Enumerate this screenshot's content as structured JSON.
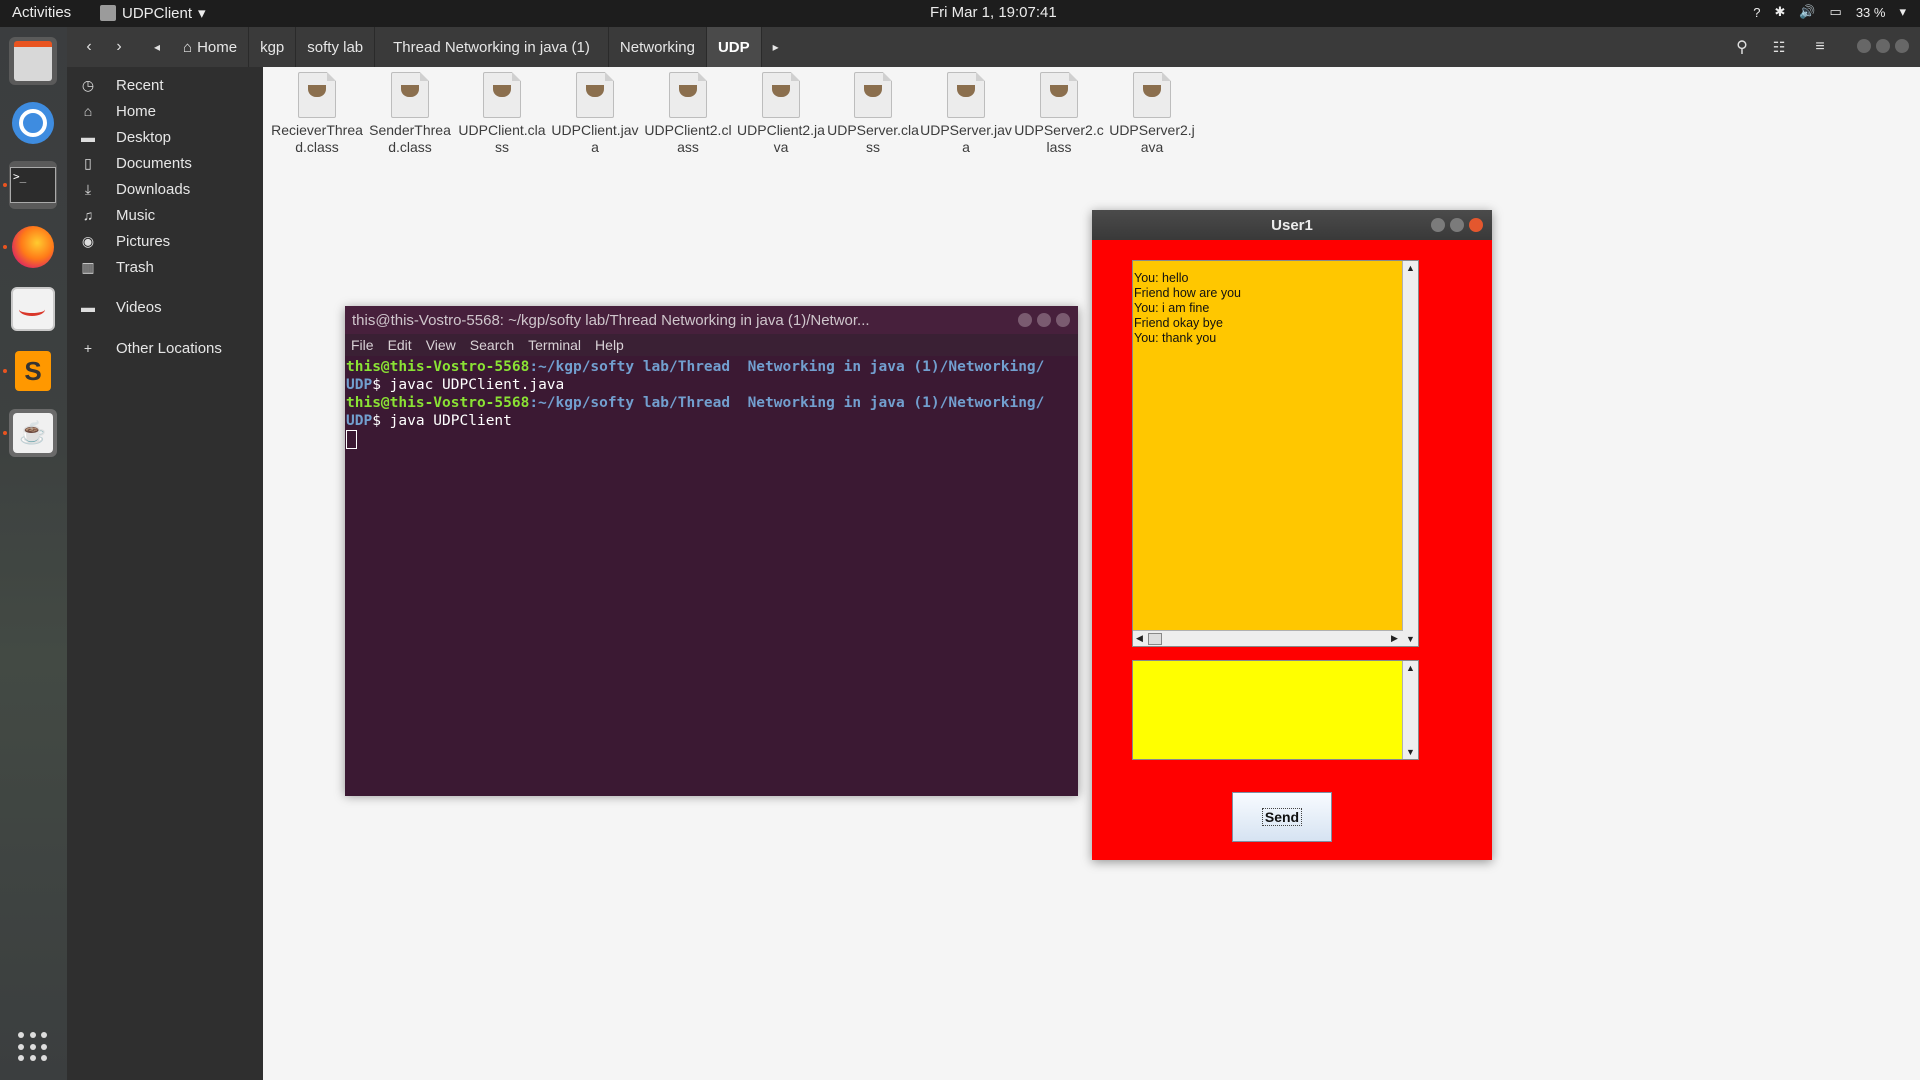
{
  "topbar": {
    "activities": "Activities",
    "app_name": "UDPClient",
    "clock": "Fri Mar  1, 19:07:41",
    "tray": {
      "help": "?",
      "battery": "33 %"
    }
  },
  "dock": {
    "items": [
      "Files",
      "Chromium",
      "Terminal",
      "Firefox",
      "Text Editor",
      "Sublime Text",
      "Java"
    ]
  },
  "fm": {
    "breadcrumbs": [
      "Home",
      "kgp",
      "softy lab",
      "Thread  Networking in java (1)",
      "Networking",
      "UDP"
    ],
    "sidebar": [
      "Recent",
      "Home",
      "Desktop",
      "Documents",
      "Downloads",
      "Music",
      "Pictures",
      "Trash",
      "Videos",
      "Other Locations"
    ],
    "files": [
      "RecieverThread.class",
      "SenderThread.class",
      "UDPClient.class",
      "UDPClient.java",
      "UDPClient2.class",
      "UDPClient2.java",
      "UDPServer.class",
      "UDPServer.java",
      "UDPServer2.class",
      "UDPServer2.java"
    ]
  },
  "terminal": {
    "title": "this@this-Vostro-5568: ~/kgp/softy lab/Thread  Networking in java (1)/Networ...",
    "menu": [
      "File",
      "Edit",
      "View",
      "Search",
      "Terminal",
      "Help"
    ],
    "lines": [
      {
        "user": "this@this-Vostro-5568",
        "path": ":~/kgp/softy lab/Thread  Networking in java (1)/Networking/",
        "path2": "UDP",
        "cmd": "$ javac UDPClient.java"
      },
      {
        "user": "this@this-Vostro-5568",
        "path": ":~/kgp/softy lab/Thread  Networking in java (1)/Networking/",
        "path2": "UDP",
        "cmd": "$ java UDPClient"
      }
    ]
  },
  "user1": {
    "title": "User1",
    "messages": [
      "You: hello",
      "Friend how are you",
      "You: i am fine",
      "Friend okay bye",
      "You: thank you"
    ],
    "input_value": "",
    "send_label": "Send"
  }
}
